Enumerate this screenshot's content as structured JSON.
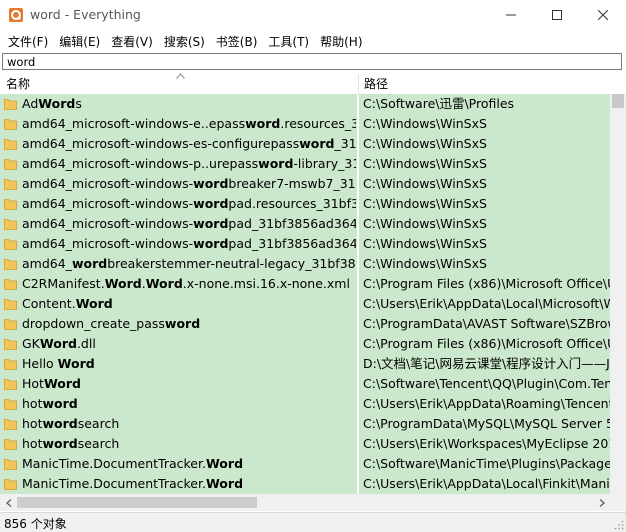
{
  "window": {
    "title": "word - Everything",
    "minimize_icon": "minimize-icon",
    "maximize_icon": "maximize-icon",
    "close_icon": "close-icon"
  },
  "menu": [
    "文件(F)",
    "编辑(E)",
    "查看(V)",
    "搜索(S)",
    "书签(B)",
    "工具(T)",
    "帮助(H)"
  ],
  "search": {
    "value": "word"
  },
  "columns": {
    "name": "名称",
    "path": "路径"
  },
  "rows": [
    {
      "name": [
        [
          "Ad",
          0
        ],
        [
          "Word",
          1
        ],
        [
          "s",
          0
        ]
      ],
      "path": "C:\\Software\\迅雷\\Profiles"
    },
    {
      "name": [
        [
          "amd64_microsoft-windows-e..epass",
          0
        ],
        [
          "word",
          1
        ],
        [
          ".resources_31...",
          0
        ]
      ],
      "path": "C:\\Windows\\WinSxS"
    },
    {
      "name": [
        [
          "amd64_microsoft-windows-es-configurepass",
          0
        ],
        [
          "word",
          1
        ],
        [
          "_31bf...",
          0
        ]
      ],
      "path": "C:\\Windows\\WinSxS"
    },
    {
      "name": [
        [
          "amd64_microsoft-windows-p..urepass",
          0
        ],
        [
          "word",
          1
        ],
        [
          "-library_31b...",
          0
        ]
      ],
      "path": "C:\\Windows\\WinSxS"
    },
    {
      "name": [
        [
          "amd64_microsoft-windows-",
          0
        ],
        [
          "word",
          1
        ],
        [
          "breaker7-mswb7_31bf...",
          0
        ]
      ],
      "path": "C:\\Windows\\WinSxS"
    },
    {
      "name": [
        [
          "amd64_microsoft-windows-",
          0
        ],
        [
          "word",
          1
        ],
        [
          "pad.resources_31bf38...",
          0
        ]
      ],
      "path": "C:\\Windows\\WinSxS"
    },
    {
      "name": [
        [
          "amd64_microsoft-windows-",
          0
        ],
        [
          "word",
          1
        ],
        [
          "pad_31bf3856ad364e...",
          0
        ]
      ],
      "path": "C:\\Windows\\WinSxS"
    },
    {
      "name": [
        [
          "amd64_microsoft-windows-",
          0
        ],
        [
          "word",
          1
        ],
        [
          "pad_31bf3856ad364e...",
          0
        ]
      ],
      "path": "C:\\Windows\\WinSxS"
    },
    {
      "name": [
        [
          "amd64_",
          0
        ],
        [
          "word",
          1
        ],
        [
          "breakerstemmer-neutral-legacy_31bf3856...",
          0
        ]
      ],
      "path": "C:\\Windows\\WinSxS"
    },
    {
      "name": [
        [
          "C2RManifest.",
          0
        ],
        [
          "Word",
          1
        ],
        [
          ".",
          0
        ],
        [
          "Word",
          1
        ],
        [
          ".x-none.msi.16.x-none.xml",
          0
        ]
      ],
      "path": "C:\\Program Files (x86)\\Microsoft Office\\Up"
    },
    {
      "name": [
        [
          "Content.",
          0
        ],
        [
          "Word",
          1
        ]
      ],
      "path": "C:\\Users\\Erik\\AppData\\Local\\Microsoft\\Wi"
    },
    {
      "name": [
        [
          "dropdown_create_pass",
          0
        ],
        [
          "word",
          1
        ]
      ],
      "path": "C:\\ProgramData\\AVAST Software\\SZBrows"
    },
    {
      "name": [
        [
          "GK",
          0
        ],
        [
          "Word",
          1
        ],
        [
          ".dll",
          0
        ]
      ],
      "path": "C:\\Program Files (x86)\\Microsoft Office\\Up"
    },
    {
      "name": [
        [
          "Hello ",
          0
        ],
        [
          "Word",
          1
        ]
      ],
      "path": "D:\\文档\\笔记\\网易云课堂\\程序设计入门——Ja"
    },
    {
      "name": [
        [
          "Hot",
          0
        ],
        [
          "Word",
          1
        ]
      ],
      "path": "C:\\Software\\Tencent\\QQ\\Plugin\\Com.Tenc"
    },
    {
      "name": [
        [
          "hot",
          0
        ],
        [
          "word",
          1
        ]
      ],
      "path": "C:\\Users\\Erik\\AppData\\Roaming\\Tencent\\("
    },
    {
      "name": [
        [
          "hot",
          0
        ],
        [
          "word",
          1
        ],
        [
          "search",
          0
        ]
      ],
      "path": "C:\\ProgramData\\MySQL\\MySQL Server 5.5"
    },
    {
      "name": [
        [
          "hot",
          0
        ],
        [
          "word",
          1
        ],
        [
          "search",
          0
        ]
      ],
      "path": "C:\\Users\\Erik\\Workspaces\\MyEclipse 2016"
    },
    {
      "name": [
        [
          "ManicTime.DocumentTracker.",
          0
        ],
        [
          "Word",
          1
        ]
      ],
      "path": "C:\\Software\\ManicTime\\Plugins\\Packages"
    },
    {
      "name": [
        [
          "ManicTime.DocumentTracker.",
          0
        ],
        [
          "Word",
          1
        ]
      ],
      "path": "C:\\Users\\Erik\\AppData\\Local\\Finkit\\ManicT"
    }
  ],
  "status": {
    "count": "856 个对象"
  },
  "icons": {
    "app": "everything-app-icon",
    "folder": "folder-icon",
    "sort": "sort-ascending-icon"
  },
  "colors": {
    "row_highlight": "#cce8cc",
    "folder": "#f2c45a"
  }
}
